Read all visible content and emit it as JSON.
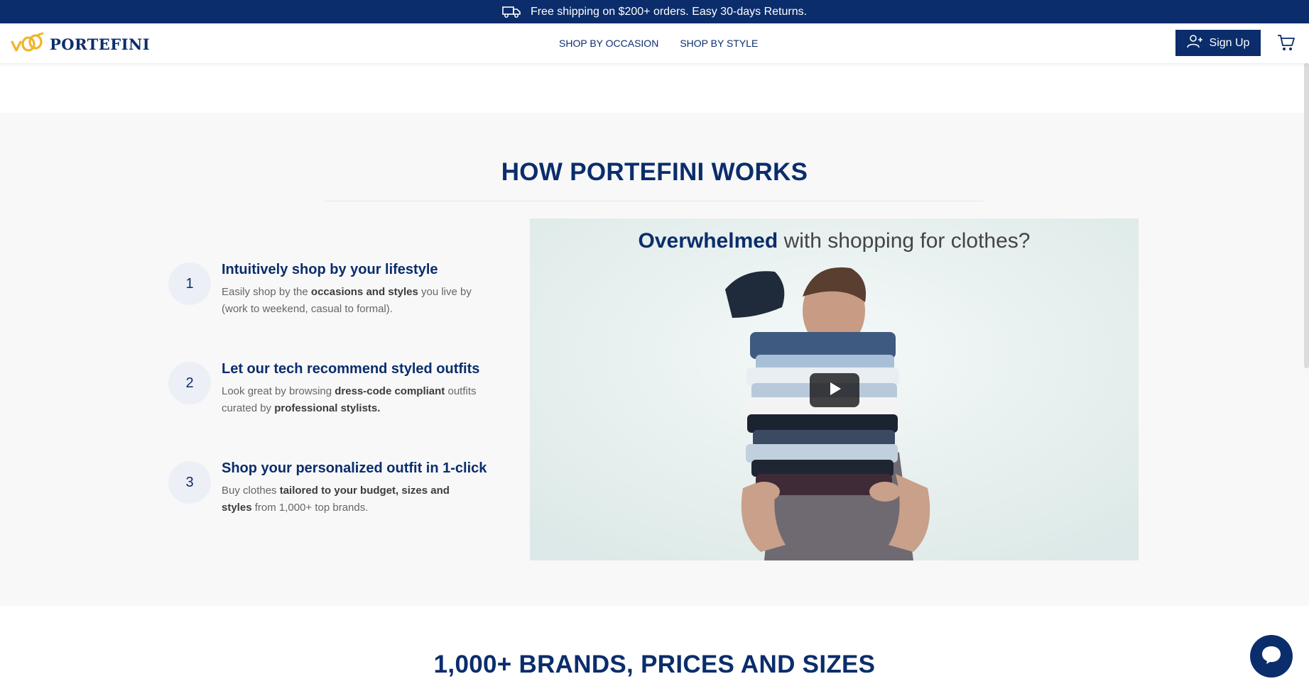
{
  "promo": {
    "icon": "truck-icon",
    "text": "Free shipping on $200+ orders. Easy 30-days Returns."
  },
  "header": {
    "logo_text": "PORTEFINI",
    "logo_color": "#f0b429",
    "nav": [
      "SHOP BY OCCASION",
      "SHOP BY STYLE"
    ],
    "signup_label": "Sign Up",
    "signup_icon": "add-user-icon",
    "cart_icon": "cart-icon"
  },
  "how_it_works": {
    "title": "HOW PORTEFINI WORKS",
    "steps": [
      {
        "number": "1",
        "title": "Intuitively shop by your lifestyle",
        "desc_a": "Easily shop by the ",
        "desc_b": "occasions and styles",
        "desc_c": " you live by (work to weekend, casual to formal)."
      },
      {
        "number": "2",
        "title": "Let our tech recommend styled outfits",
        "desc_a": "Look great by browsing ",
        "desc_b": "dress-code compliant",
        "desc_c": " outfits curated by ",
        "desc_d": "professional stylists."
      },
      {
        "number": "3",
        "title": "Shop your personalized outfit in 1-click",
        "desc_a": "Buy clothes ",
        "desc_b": "tailored to your budget, sizes and styles",
        "desc_c": " from 1,000+ top brands."
      }
    ],
    "video": {
      "caption_bold": "Overwhelmed",
      "caption_rest": " with shopping for clothes?",
      "play_icon": "play-icon"
    }
  },
  "brands": {
    "title": "1,000+ BRANDS, PRICES AND SIZES"
  },
  "chat": {
    "icon": "chat-icon"
  },
  "colors": {
    "brand_navy": "#0b2d6b",
    "section_bg": "#f8f8f9",
    "accent_gold": "#f0b429"
  }
}
